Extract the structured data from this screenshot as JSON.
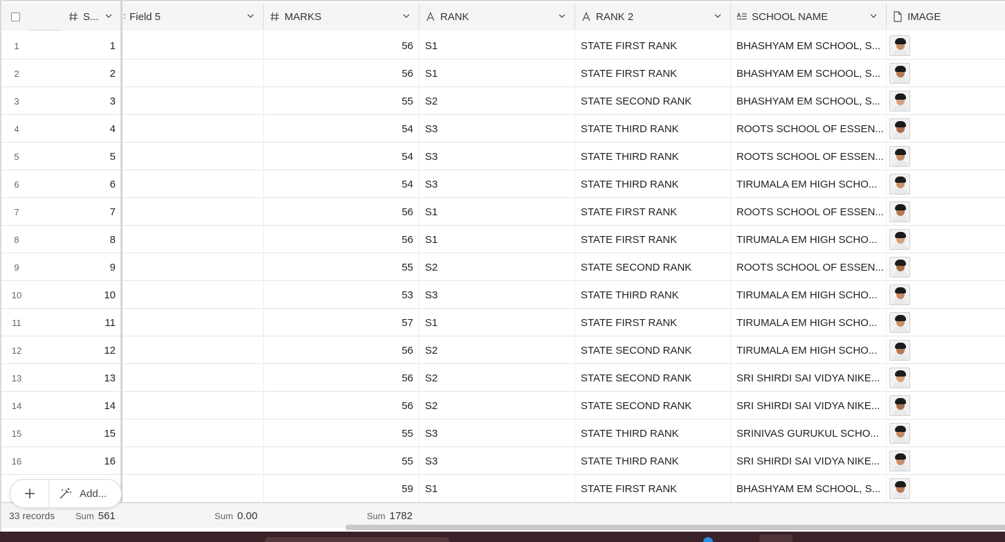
{
  "columns": {
    "s": "S...",
    "field5": "Field 5",
    "marks": "MARKS",
    "rank": "RANK",
    "rank2": "RANK 2",
    "school": "SCHOOL NAME",
    "image": "IMAGE"
  },
  "icons": {
    "number_field": "hash-icon",
    "text_field": "letter-a-icon",
    "long_text_field": "paragraph-icon",
    "attachment_field": "file-icon",
    "chevron": "chevron-down-icon",
    "add": "plus-icon",
    "add_more": "magic-wand-icon"
  },
  "rows": [
    {
      "idx": "1",
      "s": "1",
      "field5": "",
      "marks": "56",
      "rank": "S1",
      "rank2": "STATE FIRST RANK",
      "school": "BHASHYAM EM SCHOOL, S..."
    },
    {
      "idx": "2",
      "s": "2",
      "field5": "",
      "marks": "56",
      "rank": "S1",
      "rank2": "STATE FIRST RANK",
      "school": "BHASHYAM EM SCHOOL, S..."
    },
    {
      "idx": "3",
      "s": "3",
      "field5": "",
      "marks": "55",
      "rank": "S2",
      "rank2": "STATE SECOND RANK",
      "school": "BHASHYAM EM SCHOOL, S..."
    },
    {
      "idx": "4",
      "s": "4",
      "field5": "",
      "marks": "54",
      "rank": "S3",
      "rank2": "STATE THIRD RANK",
      "school": "ROOTS SCHOOL OF ESSEN..."
    },
    {
      "idx": "5",
      "s": "5",
      "field5": "",
      "marks": "54",
      "rank": "S3",
      "rank2": "STATE THIRD RANK",
      "school": "ROOTS SCHOOL OF ESSEN..."
    },
    {
      "idx": "6",
      "s": "6",
      "field5": "",
      "marks": "54",
      "rank": "S3",
      "rank2": "STATE THIRD RANK",
      "school": "TIRUMALA EM HIGH SCHO..."
    },
    {
      "idx": "7",
      "s": "7",
      "field5": "",
      "marks": "56",
      "rank": "S1",
      "rank2": "STATE FIRST RANK",
      "school": "ROOTS SCHOOL OF ESSEN..."
    },
    {
      "idx": "8",
      "s": "8",
      "field5": "",
      "marks": "56",
      "rank": "S1",
      "rank2": "STATE FIRST RANK",
      "school": "TIRUMALA EM HIGH SCHO..."
    },
    {
      "idx": "9",
      "s": "9",
      "field5": "",
      "marks": "55",
      "rank": "S2",
      "rank2": "STATE SECOND RANK",
      "school": "ROOTS SCHOOL OF ESSEN..."
    },
    {
      "idx": "10",
      "s": "10",
      "field5": "",
      "marks": "53",
      "rank": "S3",
      "rank2": "STATE THIRD RANK",
      "school": "TIRUMALA EM HIGH SCHO..."
    },
    {
      "idx": "11",
      "s": "11",
      "field5": "",
      "marks": "57",
      "rank": "S1",
      "rank2": "STATE FIRST RANK",
      "school": "TIRUMALA EM HIGH SCHO..."
    },
    {
      "idx": "12",
      "s": "12",
      "field5": "",
      "marks": "56",
      "rank": "S2",
      "rank2": "STATE SECOND RANK",
      "school": "TIRUMALA EM HIGH SCHO..."
    },
    {
      "idx": "13",
      "s": "13",
      "field5": "",
      "marks": "56",
      "rank": "S2",
      "rank2": "STATE SECOND RANK",
      "school": "SRI SHIRDI SAI VIDYA NIKE..."
    },
    {
      "idx": "14",
      "s": "14",
      "field5": "",
      "marks": "56",
      "rank": "S2",
      "rank2": "STATE SECOND RANK",
      "school": "SRI SHIRDI SAI VIDYA NIKE..."
    },
    {
      "idx": "15",
      "s": "15",
      "field5": "",
      "marks": "55",
      "rank": "S3",
      "rank2": "STATE THIRD RANK",
      "school": "SRINIVAS GURUKUL SCHO..."
    },
    {
      "idx": "16",
      "s": "16",
      "field5": "",
      "marks": "55",
      "rank": "S3",
      "rank2": "STATE THIRD RANK",
      "school": "SRI SHIRDI SAI VIDYA NIKE..."
    },
    {
      "idx": "",
      "s": "",
      "field5": "",
      "marks": "59",
      "rank": "S1",
      "rank2": "STATE FIRST RANK",
      "school": "BHASHYAM EM SCHOOL, S..."
    }
  ],
  "add_more_label": "Add...",
  "footer": {
    "records": "33 records",
    "sum_label": "Sum",
    "sum_s": "561",
    "sum_field5": "0.00",
    "sum_marks": "1782"
  }
}
